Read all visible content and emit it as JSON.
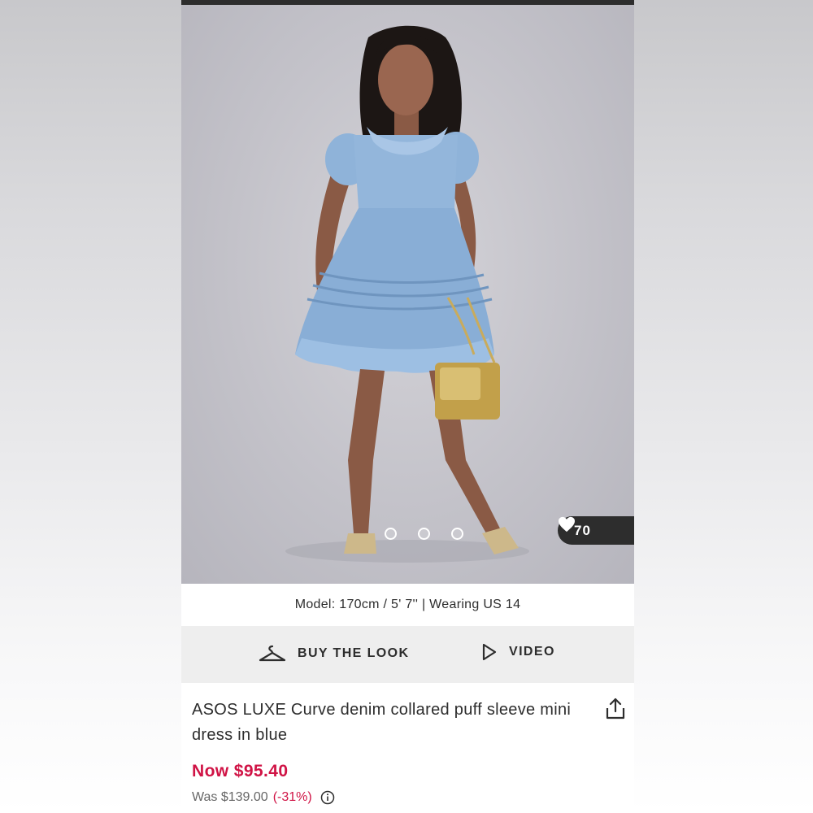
{
  "gallery": {
    "image_alt": "Model wearing denim collared puff sleeve mini dress",
    "dots": 3,
    "likes": "70"
  },
  "model_info": "Model: 170cm / 5' 7'' | Wearing US 14",
  "actions": {
    "buy_the_look": "BUY THE LOOK",
    "video": "VIDEO"
  },
  "product": {
    "title": "ASOS LUXE Curve denim collared puff sleeve mini dress in blue",
    "now_price": "Now $95.40",
    "was_price": "Was $139.00",
    "discount": "(-31%)"
  },
  "colors": {
    "sale_red": "#d01345",
    "dark": "#2d2d2d",
    "denim": "#8fb3d9"
  },
  "icons": [
    "hanger-icon",
    "play-icon",
    "heart-icon",
    "share-icon",
    "info-icon"
  ]
}
